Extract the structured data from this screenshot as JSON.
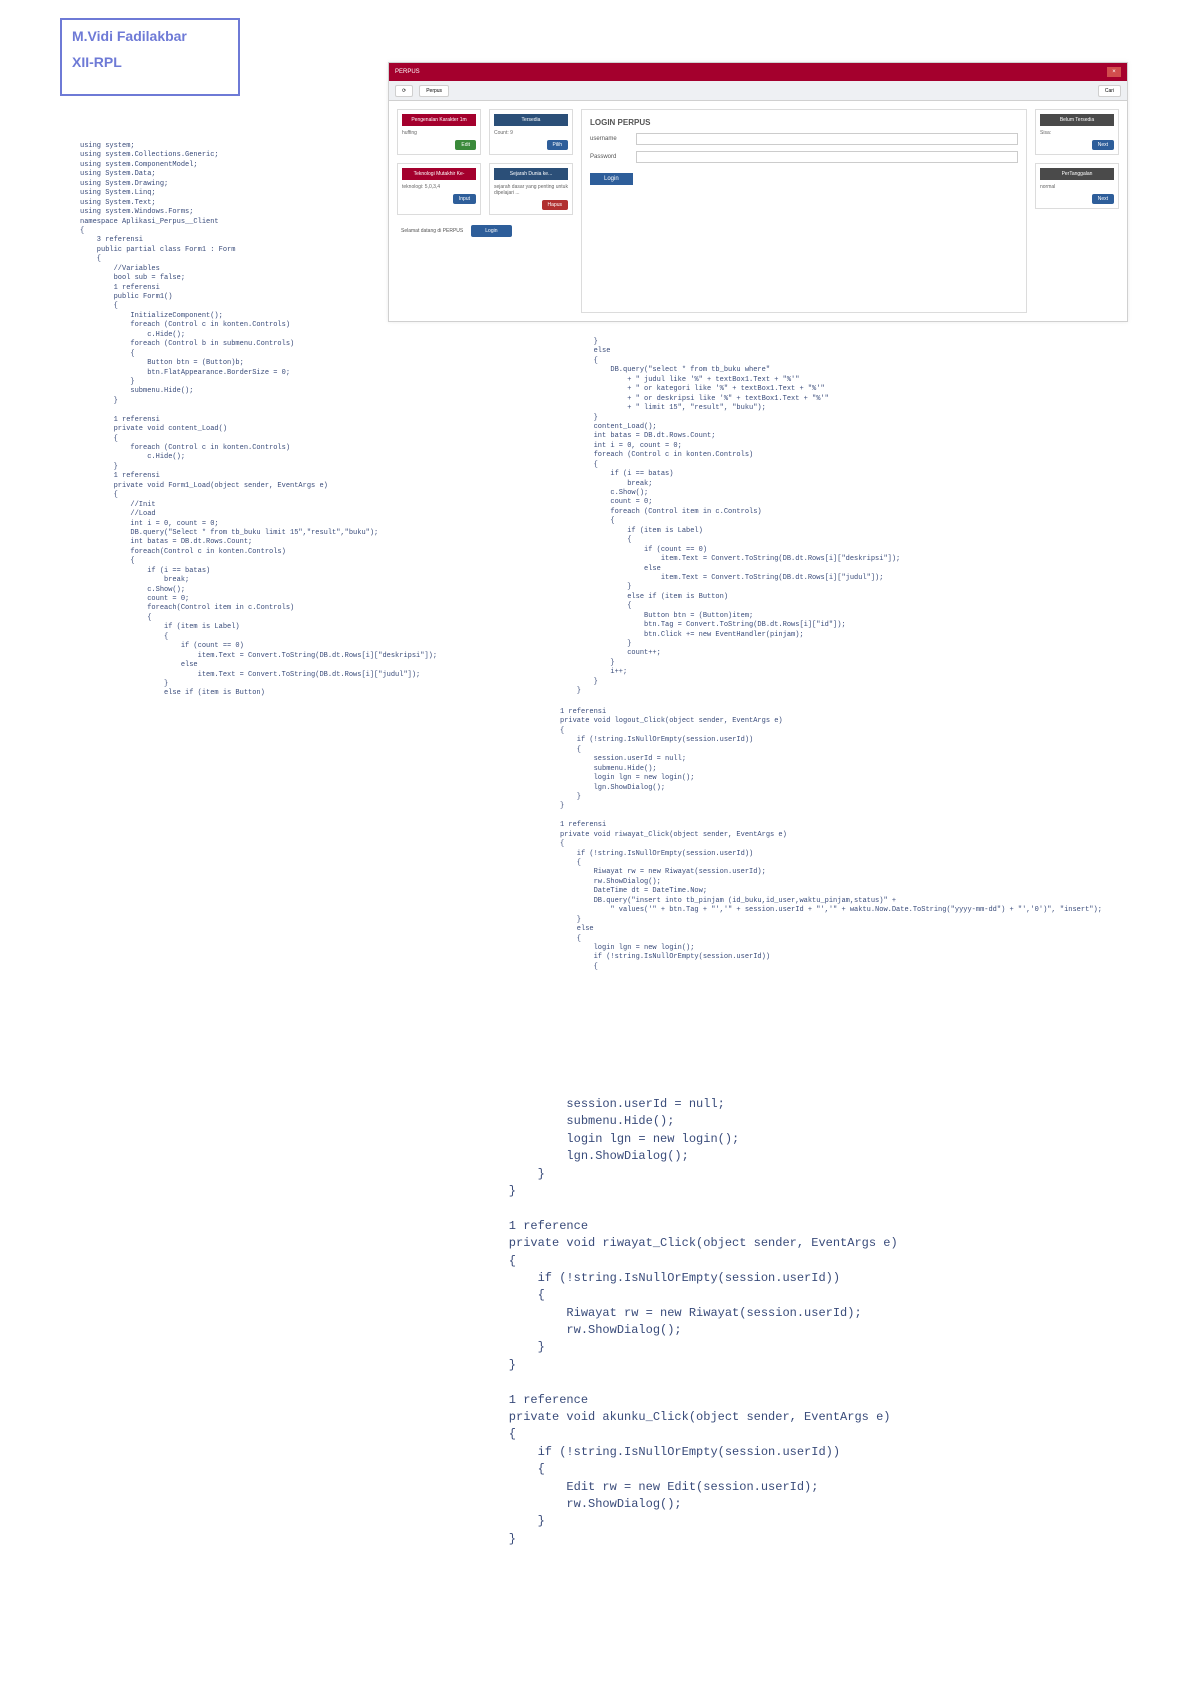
{
  "header": {
    "title": "M.Vidi Fadilakbar",
    "subtitle": "XII-RPL"
  },
  "app": {
    "titlebar": "PERPUS",
    "close_glyph": "×",
    "toolbar": {
      "search_placeholder": "",
      "ok_label": "Perpus",
      "right_label": "Cari"
    },
    "panels": {
      "p1": {
        "head": "Pengenalan Karakter 1m",
        "label": "huffing"
      },
      "p2": {
        "head": "Tersedia",
        "label": "Count: 9"
      },
      "p3": {
        "head": "Belum Tersedia",
        "label": "Sisa:"
      },
      "p4": {
        "head": "PerTanggalan",
        "label": "normal"
      },
      "p5": {
        "head": "Teknologi Mutakhir Ke-",
        "label": "teknologi: 5,0,3,4"
      },
      "p6": {
        "head": "Sejarah Dunia ke...",
        "label": "sejarah dasar yang penting untuk dipelajari ..."
      }
    },
    "login": {
      "title": "LOGIN PERPUS",
      "username_label": "username",
      "password_label": "Password",
      "button": "Login"
    },
    "btn_green": "Edit",
    "btn_blue": "Pilih",
    "btn_next": "Next",
    "btn_blue2": "Input",
    "btn_red": "Hapus",
    "status_text": "Selamat datang di PERPUS",
    "status_pill": "Login"
  },
  "code_left": "using system;\nusing system.Collections.Generic;\nusing system.ComponentModel;\nusing System.Data;\nusing System.Drawing;\nusing System.Linq;\nusing System.Text;\nusing system.Windows.Forms;\nnamespace Aplikasi_Perpus__Client\n{\n    3 referensi\n    public partial class Form1 : Form\n    {\n        //Variables\n        bool sub = false;\n        1 referensi\n        public Form1()\n        {\n            InitializeComponent();\n            foreach (Control c in konten.Controls)\n                c.Hide();\n            foreach (Control b in submenu.Controls)\n            {\n                Button btn = (Button)b;\n                btn.FlatAppearance.BorderSize = 0;\n            }\n            submenu.Hide();\n        }\n\n        1 referensi\n        private void content_Load()\n        {\n            foreach (Control c in konten.Controls)\n                c.Hide();\n        }\n        1 referensi\n        private void Form1_Load(object sender, EventArgs e)\n        {\n            //Init\n            //Load\n            int i = 0, count = 0;\n            DB.query(\"Select * from tb_buku limit 15\",\"result\",\"buku\");\n            int batas = DB.dt.Rows.Count;\n            foreach(Control c in konten.Controls)\n            {\n                if (i == batas)\n                    break;\n                c.Show();\n                count = 0;\n                foreach(Control item in c.Controls)\n                {\n                    if (item is Label)\n                    {\n                        if (count == 0)\n                            item.Text = Convert.ToString(DB.dt.Rows[i][\"deskripsi\"]);\n                        else\n                            item.Text = Convert.ToString(DB.dt.Rows[i][\"judul\"]);\n                    }\n                    else if (item is Button)",
  "code_right_top": "        }\n        else\n        {\n            DB.query(\"select * from tb_buku where\"\n                + \" judul like '%\" + textBox1.Text + \"%'\"\n                + \" or kategori like '%\" + textBox1.Text + \"%'\"\n                + \" or deskripsi like '%\" + textBox1.Text + \"%'\"\n                + \" limit 15\", \"result\", \"buku\");\n        }\n        content_Load();\n        int batas = DB.dt.Rows.Count;\n        int i = 0, count = 0;\n        foreach (Control c in konten.Controls)\n        {\n            if (i == batas)\n                break;\n            c.Show();\n            count = 0;\n            foreach (Control item in c.Controls)\n            {\n                if (item is Label)\n                {\n                    if (count == 0)\n                        item.Text = Convert.ToString(DB.dt.Rows[i][\"deskripsi\"]);\n                    else\n                        item.Text = Convert.ToString(DB.dt.Rows[i][\"judul\"]);\n                }\n                else if (item is Button)\n                {\n                    Button btn = (Button)item;\n                    btn.Tag = Convert.ToString(DB.dt.Rows[i][\"id\"]);\n                    btn.Click += new EventHandler(pinjam);\n                }\n                count++;\n            }\n            i++;\n        }\n    }",
  "code_right_mid": "1 referensi\nprivate void logout_Click(object sender, EventArgs e)\n{\n    if (!string.IsNullOrEmpty(session.userId))\n    {\n        session.userId = null;\n        submenu.Hide();\n        login lgn = new login();\n        lgn.ShowDialog();\n    }\n}\n\n1 referensi\nprivate void riwayat_Click(object sender, EventArgs e)\n{\n    if (!string.IsNullOrEmpty(session.userId))\n    {\n        Riwayat rw = new Riwayat(session.userId);\n        rw.ShowDialog();\n        DateTime dt = DateTime.Now;\n        DB.query(\"insert into tb_pinjam (id_buku,id_user,waktu_pinjam,status)\" +\n            \" values('\" + btn.Tag + \"','\" + session.userId + \"','\" + waktu.Now.Date.ToString(\"yyyy-mm-dd\") + \"','0')\", \"insert\");\n    }\n    else\n    {\n        login lgn = new login();\n        if (!string.IsNullOrEmpty(session.userId))\n        {",
  "code_right_bottom": "            session.userId = null;\n            submenu.Hide();\n            login lgn = new login();\n            lgn.ShowDialog();\n        }\n    }\n\n    1 reference\n    private void riwayat_Click(object sender, EventArgs e)\n    {\n        if (!string.IsNullOrEmpty(session.userId))\n        {\n            Riwayat rw = new Riwayat(session.userId);\n            rw.ShowDialog();\n        }\n    }\n\n    1 reference\n    private void akunku_Click(object sender, EventArgs e)\n    {\n        if (!string.IsNullOrEmpty(session.userId))\n        {\n            Edit rw = new Edit(session.userId);\n            rw.ShowDialog();\n        }\n    }"
}
